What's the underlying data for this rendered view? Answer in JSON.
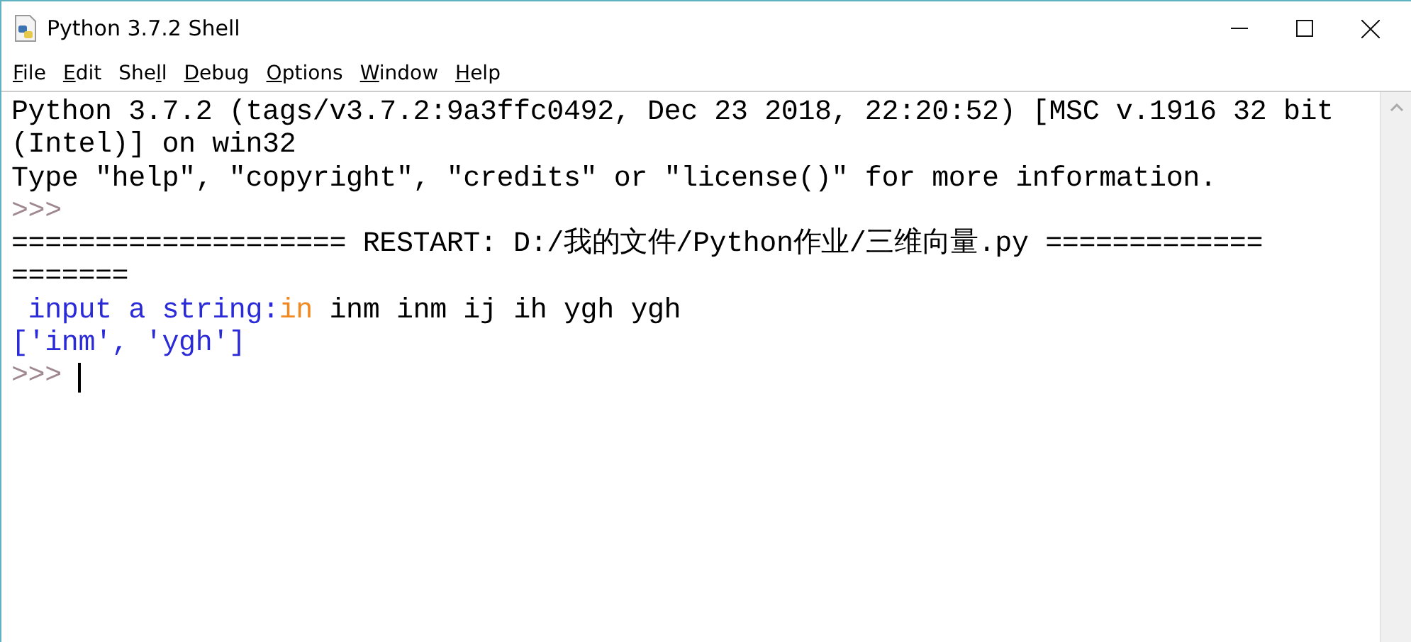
{
  "window": {
    "title": "Python 3.7.2 Shell"
  },
  "menu": [
    {
      "key": "F",
      "post": "ile"
    },
    {
      "key": "E",
      "post": "dit"
    },
    {
      "pre": "She",
      "key": "l",
      "post": "l"
    },
    {
      "key": "D",
      "post": "ebug"
    },
    {
      "key": "O",
      "post": "ptions"
    },
    {
      "key": "W",
      "post": "indow"
    },
    {
      "key": "H",
      "post": "elp"
    }
  ],
  "shell_lines": [
    {
      "segments": [
        {
          "kind": "output",
          "text": "Python 3.7.2 (tags/v3.7.2:9a3ffc0492, Dec 23 2018, 22:20:52) [MSC v.1916 32 bit"
        }
      ]
    },
    {
      "segments": [
        {
          "kind": "output",
          "text": "(Intel)] on win32"
        }
      ]
    },
    {
      "segments": [
        {
          "kind": "output",
          "text": "Type \"help\", \"copyright\", \"credits\" or \"license()\" for more information."
        }
      ]
    },
    {
      "segments": [
        {
          "kind": "prompt",
          "text": ">>>"
        }
      ]
    },
    {
      "segments": [
        {
          "kind": "output",
          "text": "==================== RESTART: D:/我的文件/Python作业/三维向量.py ============="
        }
      ]
    },
    {
      "segments": [
        {
          "kind": "output",
          "text": "======="
        }
      ]
    },
    {
      "segments": [
        {
          "kind": "stdout",
          "text": " input a string:"
        },
        {
          "kind": "builtin",
          "text": "in"
        },
        {
          "kind": "output",
          "text": " inm inm ij ih ygh ygh"
        }
      ]
    },
    {
      "segments": [
        {
          "kind": "stdout",
          "text": "['inm', 'ygh']"
        }
      ]
    },
    {
      "segments": [
        {
          "kind": "prompt",
          "text": ">>>"
        }
      ],
      "cursor": true
    }
  ]
}
